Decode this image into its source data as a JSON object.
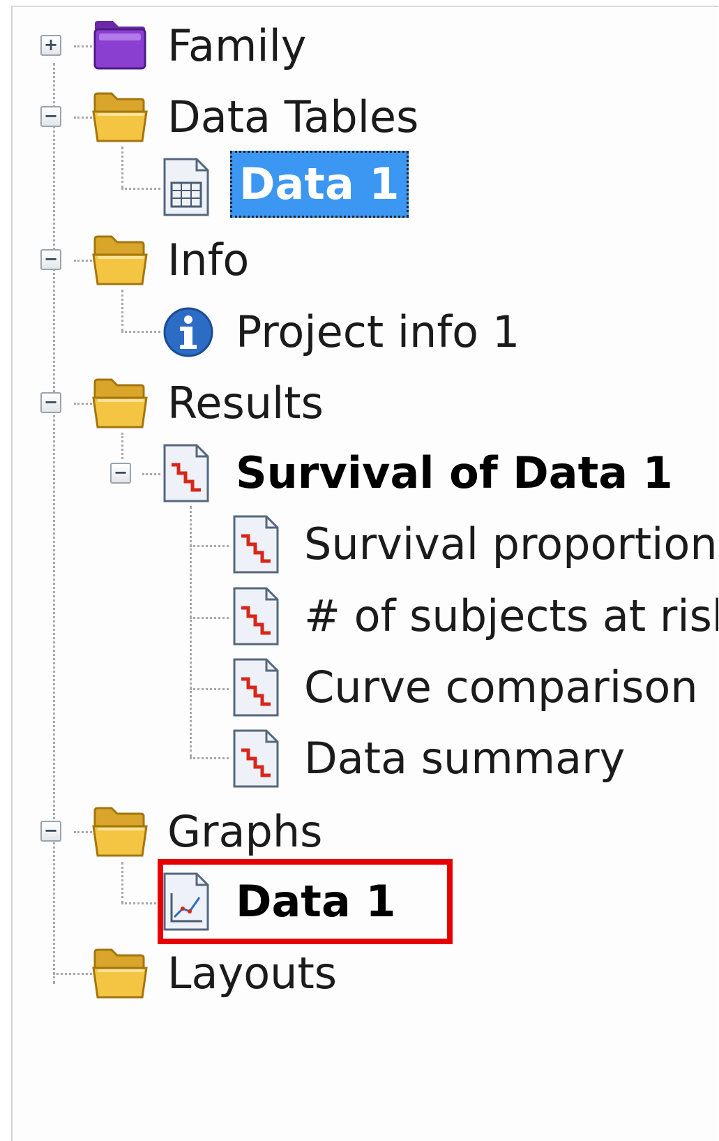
{
  "tree": {
    "expander": {
      "plus": "+",
      "minus": "−"
    },
    "family": {
      "label": "Family",
      "icon": "folder-purple-icon"
    },
    "data_tables": {
      "label": "Data Tables",
      "icon": "folder-open-icon",
      "children": [
        {
          "label": "Data 1",
          "icon": "data-table-icon",
          "selected": true
        }
      ]
    },
    "info": {
      "label": "Info",
      "icon": "folder-open-icon",
      "children": [
        {
          "label": "Project info 1",
          "icon": "info-icon"
        }
      ]
    },
    "results": {
      "label": "Results",
      "icon": "folder-open-icon",
      "children": [
        {
          "label": "Survival of Data 1",
          "icon": "survival-result-icon",
          "children": [
            {
              "label": "Survival proportions",
              "icon": "survival-result-icon"
            },
            {
              "label": "# of subjects at risk",
              "icon": "survival-result-icon"
            },
            {
              "label": "Curve comparison",
              "icon": "survival-result-icon"
            },
            {
              "label": "Data summary",
              "icon": "survival-result-icon"
            }
          ]
        }
      ]
    },
    "graphs": {
      "label": "Graphs",
      "icon": "folder-open-icon",
      "children": [
        {
          "label": "Data 1",
          "icon": "graph-icon",
          "highlighted": true
        }
      ]
    },
    "layouts": {
      "label": "Layouts",
      "icon": "folder-open-icon"
    }
  },
  "colors": {
    "selection": "#3b97f1",
    "highlight_box": "#e60000",
    "folder_yellow": "#f4c542",
    "folder_purple": "#8a3fd1",
    "info_blue": "#2c6cc4",
    "survival_red": "#d8261a"
  }
}
